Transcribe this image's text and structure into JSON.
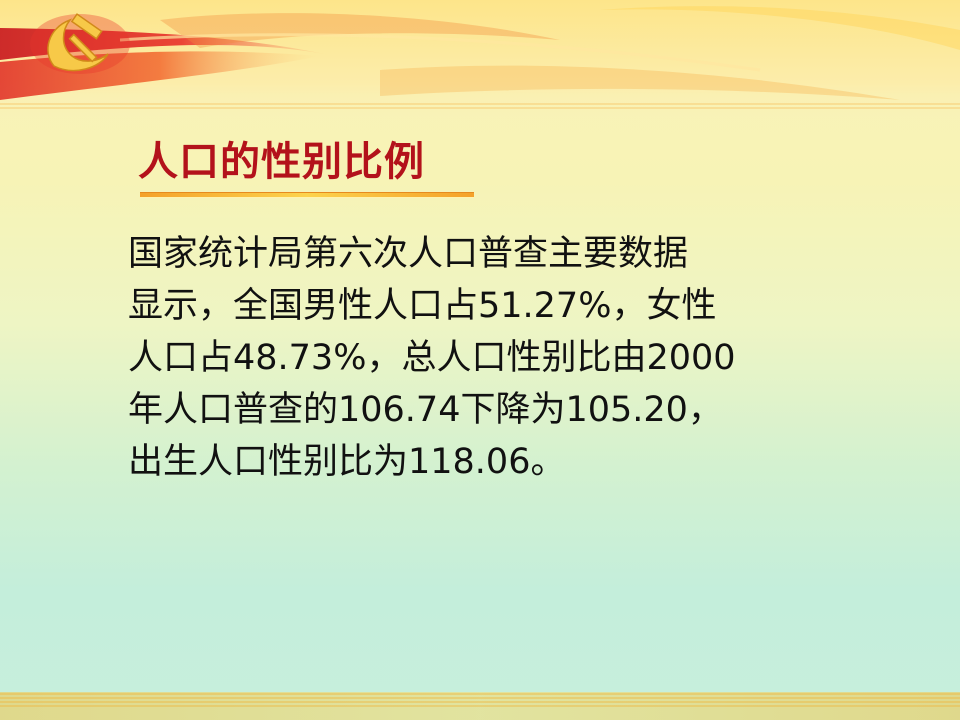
{
  "slide": {
    "title": "人口的性别比例",
    "body_lines": [
      "国家统计局第六次人口普查主要数据",
      "显示，全国男性人口占51.27%，女性",
      "人口占48.73%，总人口性别比由2000",
      "年人口普查的106.74下降为105.20，",
      "出生人口性别比为118.06。"
    ]
  },
  "theme": {
    "title_color": "#b3121b",
    "accent_red": "#c8161d",
    "accent_gold": "#f4a12a"
  },
  "icons": {
    "emblem": "hammer-and-sickle-emblem"
  }
}
